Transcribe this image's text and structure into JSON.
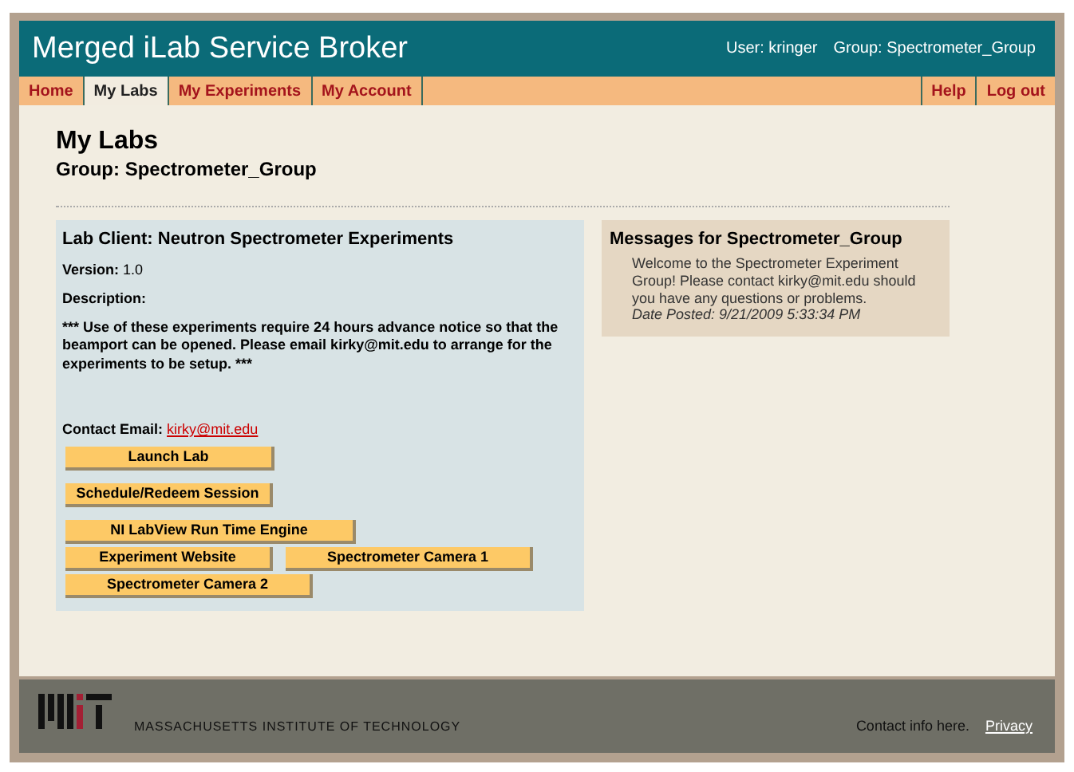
{
  "header": {
    "title": "Merged iLab Service Broker",
    "user": "User: kringer",
    "group": "Group: Spectrometer_Group"
  },
  "nav_left": [
    {
      "label": "Home",
      "selected": false
    },
    {
      "label": "My Labs",
      "selected": true
    },
    {
      "label": "My Experiments",
      "selected": false
    },
    {
      "label": "My Account",
      "selected": false
    }
  ],
  "nav_right": [
    {
      "label": "Help",
      "selected": false
    },
    {
      "label": "Log out",
      "selected": false
    }
  ],
  "page": {
    "title": "My Labs",
    "subtitle": "Group: Spectrometer_Group"
  },
  "lab_client": {
    "title": "Lab Client: Neutron Spectrometer Experiments",
    "version_label": "Version:",
    "version": "1.0",
    "description_label": "Description:",
    "description": "*** Use of these experiments require 24 hours advance notice so that the beamport can be opened. Please email kirky@mit.edu to arrange for the experiments to be setup. ***",
    "contact_label": "Contact Email:",
    "contact_email": "kirky@mit.edu",
    "button_rows": [
      [
        "Launch Lab"
      ],
      [
        "Schedule/Redeem Session"
      ],
      [
        "NI LabView Run Time Engine"
      ],
      [
        "Experiment Website",
        "Spectrometer Camera 1"
      ],
      [
        "Spectrometer Camera 2"
      ]
    ]
  },
  "messages": {
    "title": "Messages for Spectrometer_Group",
    "body": "Welcome to the Spectrometer Experiment Group! Please contact kirky@mit.edu should you have any questions or problems.",
    "date": "Date Posted: 9/21/2009 5:33:34 PM"
  },
  "footer": {
    "institute": "MASSACHUSETTS INSTITUTE OF TECHNOLOGY",
    "contact": "Contact info here.",
    "privacy": "Privacy"
  }
}
